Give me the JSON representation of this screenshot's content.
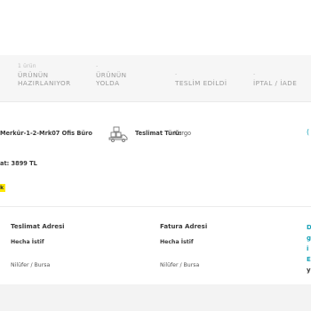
{
  "status_steps": [
    {
      "caption": "1 ürün",
      "line1": "ÜRÜNÜN",
      "line2": "HAZIRLANIYOR"
    },
    {
      "caption": "-",
      "line1": "ÜRÜNÜN",
      "line2": "YOLDA"
    },
    {
      "caption": "-",
      "line1": "",
      "line2": "TESLİM EDİLDİ"
    },
    {
      "caption": "-",
      "line1": "",
      "line2": "İPTAL / İADE"
    }
  ],
  "order": {
    "store_name": "Merkür-1-2-Mrk07 Ofis Büro",
    "shipping_label": "Teslimat Türü:",
    "shipping_value": "Kargo",
    "truck_icon": "delivery-truck-icon",
    "edge_glyph": "("
  },
  "price_text": "at: 3899 TL",
  "badge_text": "k",
  "delivery_address": {
    "title": "Teslimat Adresi",
    "name": "Hecha İstif",
    "city": "Nilüfer / Bursa"
  },
  "billing_address": {
    "title": "Fatura Adresi",
    "name": "Hecha İstif",
    "city": "Nilüfer / Bursa"
  },
  "edge_links": [
    "D",
    "g",
    "i",
    "E",
    "y"
  ],
  "colors": {
    "accent": "#17a2b8",
    "badge": "#ffe800",
    "muted": "#9a9a9a"
  }
}
